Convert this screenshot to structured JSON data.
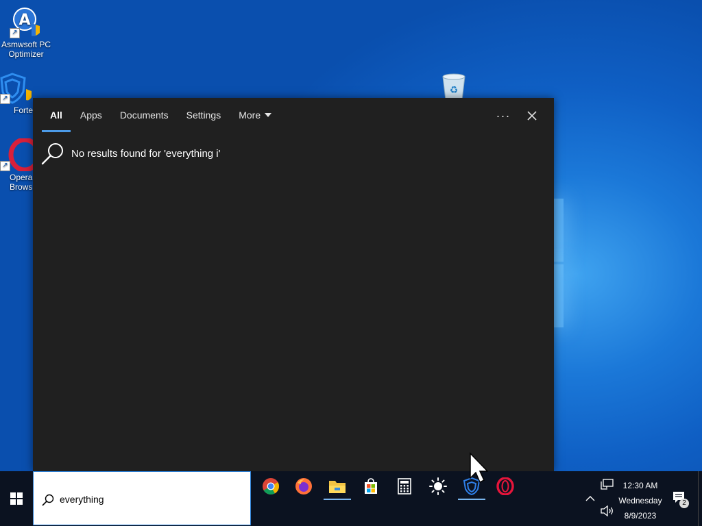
{
  "desktop": {
    "icons": [
      {
        "label": "Asmwsoft PC Optimizer"
      },
      {
        "label": "Forte"
      },
      {
        "label": "Opera Brows"
      }
    ]
  },
  "search_panel": {
    "tabs": [
      {
        "label": "All",
        "active": true
      },
      {
        "label": "Apps"
      },
      {
        "label": "Documents"
      },
      {
        "label": "Settings"
      },
      {
        "label": "More"
      }
    ],
    "more_options_label": "···",
    "close_label": "✕",
    "no_results_text": "No results found for 'everything i'"
  },
  "taskbar": {
    "search": {
      "value": "everything"
    },
    "apps": [
      {
        "icon": "chrome-icon"
      },
      {
        "icon": "firefox-icon"
      },
      {
        "icon": "file-explorer-icon",
        "running": true
      },
      {
        "icon": "store-icon"
      },
      {
        "icon": "calculator-icon"
      },
      {
        "icon": "brightness-icon"
      },
      {
        "icon": "fortect-icon",
        "running": true
      },
      {
        "icon": "opera-icon"
      }
    ],
    "clock": {
      "time": "12:30 AM",
      "day": "Wednesday",
      "date": "8/9/2023"
    },
    "notification_count": "2"
  },
  "colors": {
    "accent": "#4c9be8",
    "panel_bg": "#202020",
    "taskbar_bg": "#0b1220"
  }
}
